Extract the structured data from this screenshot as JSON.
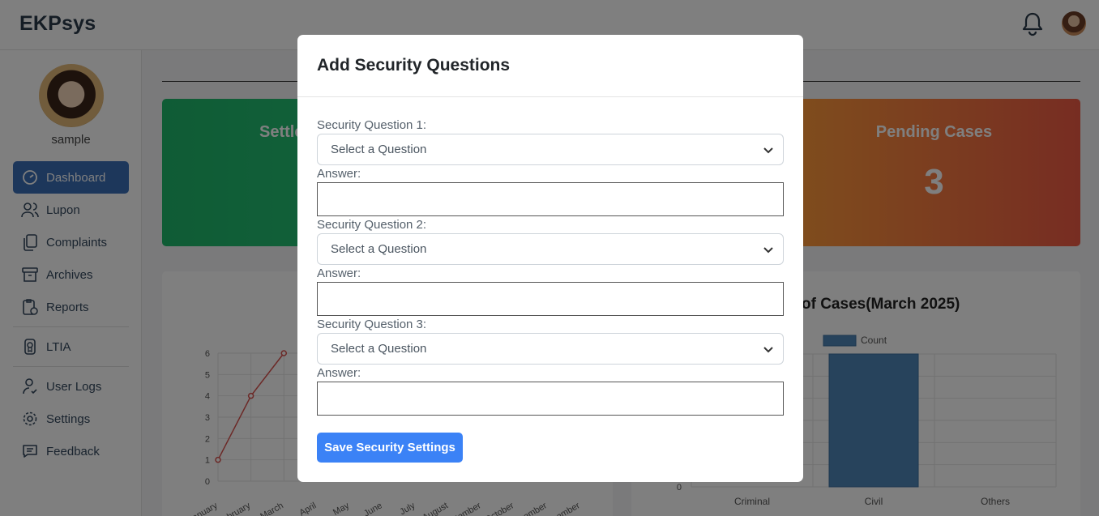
{
  "header": {
    "brand": "EKPsys"
  },
  "sidebar": {
    "username": "sample",
    "items": [
      {
        "label": "Dashboard",
        "icon": "speedometer-icon"
      },
      {
        "label": "Lupon",
        "icon": "users-icon"
      },
      {
        "label": "Complaints",
        "icon": "documents-icon"
      },
      {
        "label": "Archives",
        "icon": "archive-box-icon"
      },
      {
        "label": "Reports",
        "icon": "report-icon"
      },
      {
        "label": "LTIA",
        "icon": "award-icon"
      },
      {
        "label": "User Logs",
        "icon": "user-check-icon"
      },
      {
        "label": "Settings",
        "icon": "gear-icon"
      },
      {
        "label": "Feedback",
        "icon": "message-icon"
      }
    ]
  },
  "dashboard": {
    "card_settled_title": "Settle",
    "card_pending_title": "Pending Cases",
    "card_pending_value": "3",
    "chart_right_title": "of Cases(March 2025)"
  },
  "chart_data": [
    {
      "type": "line",
      "categories": [
        "January",
        "February",
        "March",
        "April",
        "May",
        "June",
        "July",
        "August",
        "September",
        "October",
        "November",
        "December"
      ],
      "series": [
        {
          "values": [
            1,
            4,
            6,
            null,
            null,
            null,
            null,
            null,
            null,
            null,
            null,
            null
          ]
        }
      ],
      "yticks": [
        "0",
        "1",
        "2",
        "3",
        "4",
        "5",
        "6"
      ],
      "ylim": [
        0,
        6
      ]
    },
    {
      "type": "bar",
      "title": "of Cases(March 2025)",
      "categories": [
        "Criminal",
        "Civil",
        "Others"
      ],
      "series": [
        {
          "name": "Count",
          "values": [
            0,
            3,
            0
          ]
        }
      ],
      "yticks": [
        "0"
      ],
      "legend": "top"
    }
  ],
  "modal": {
    "title": "Add Security Questions",
    "q1_label": "Security Question 1:",
    "q2_label": "Security Question 2:",
    "q3_label": "Security Question 3:",
    "answer_label": "Answer:",
    "select_placeholder": "Select a Question",
    "save_label": "Save Security Settings"
  },
  "colors": {
    "accent": "#3b82f6",
    "sidebar_active": "#3b6fb6",
    "card_green": "#1fb86b",
    "card_orange": "#ef5a45",
    "line_series": "#d9534f",
    "bar_series": "#4e86b8"
  }
}
